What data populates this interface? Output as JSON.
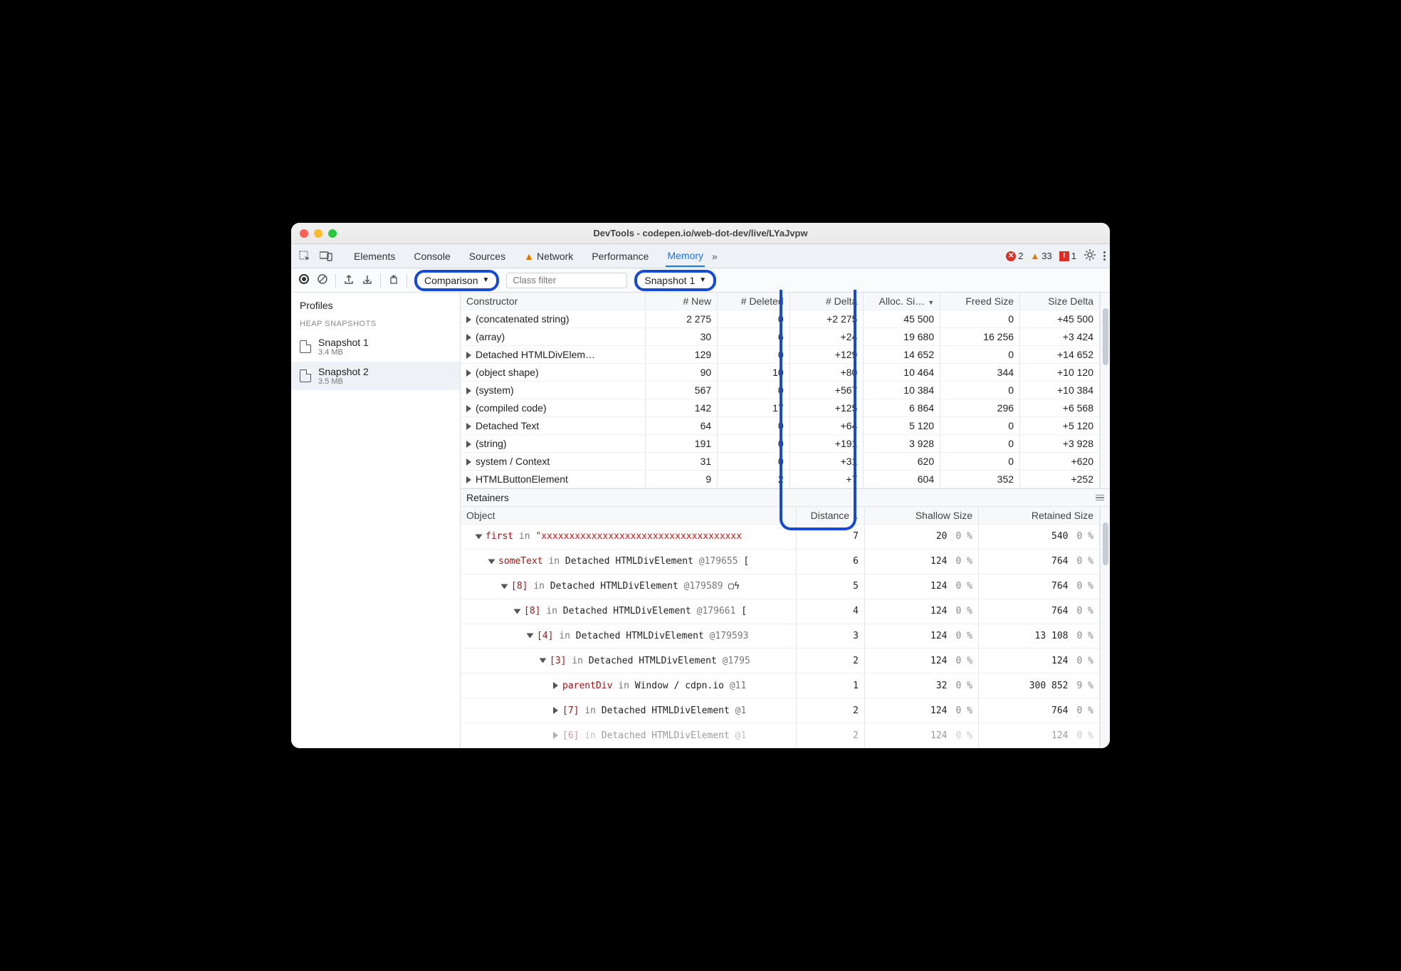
{
  "window_title": "DevTools - codepen.io/web-dot-dev/live/LYaJvpw",
  "tabs": {
    "items": [
      "Elements",
      "Console",
      "Sources",
      "Network",
      "Performance",
      "Memory"
    ],
    "active": "Memory"
  },
  "badges": {
    "errors": 2,
    "warnings": 33,
    "issues": 1
  },
  "toolbar": {
    "view_select": "Comparison",
    "filter_placeholder": "Class filter",
    "baseline_select": "Snapshot 1"
  },
  "sidebar": {
    "title": "Profiles",
    "section": "HEAP SNAPSHOTS",
    "snapshots": [
      {
        "name": "Snapshot 1",
        "size": "3.4 MB",
        "selected": false
      },
      {
        "name": "Snapshot 2",
        "size": "3.5 MB",
        "selected": true
      }
    ]
  },
  "comparison": {
    "headers": [
      "Constructor",
      "# New",
      "# Deleted",
      "# Delta",
      "Alloc. Si…",
      "Freed Size",
      "Size Delta"
    ],
    "sort_col": 4,
    "rows": [
      {
        "name": "(concatenated string)",
        "new": "2 275",
        "del": "0",
        "delta": "+2 275",
        "alloc": "45 500",
        "freed": "0",
        "sized": "+45 500"
      },
      {
        "name": "(array)",
        "new": "30",
        "del": "6",
        "delta": "+24",
        "alloc": "19 680",
        "freed": "16 256",
        "sized": "+3 424"
      },
      {
        "name": "Detached HTMLDivElem…",
        "new": "129",
        "del": "0",
        "delta": "+129",
        "alloc": "14 652",
        "freed": "0",
        "sized": "+14 652"
      },
      {
        "name": "(object shape)",
        "new": "90",
        "del": "10",
        "delta": "+80",
        "alloc": "10 464",
        "freed": "344",
        "sized": "+10 120"
      },
      {
        "name": "(system)",
        "new": "567",
        "del": "0",
        "delta": "+567",
        "alloc": "10 384",
        "freed": "0",
        "sized": "+10 384"
      },
      {
        "name": "(compiled code)",
        "new": "142",
        "del": "17",
        "delta": "+125",
        "alloc": "6 864",
        "freed": "296",
        "sized": "+6 568"
      },
      {
        "name": "Detached Text",
        "new": "64",
        "del": "0",
        "delta": "+64",
        "alloc": "5 120",
        "freed": "0",
        "sized": "+5 120"
      },
      {
        "name": "(string)",
        "new": "191",
        "del": "0",
        "delta": "+191",
        "alloc": "3 928",
        "freed": "0",
        "sized": "+3 928"
      },
      {
        "name": "system / Context",
        "new": "31",
        "del": "0",
        "delta": "+31",
        "alloc": "620",
        "freed": "0",
        "sized": "+620"
      },
      {
        "name": "HTMLButtonElement",
        "new": "9",
        "del": "2",
        "delta": "+7",
        "alloc": "604",
        "freed": "352",
        "sized": "+252"
      }
    ]
  },
  "retainers": {
    "title": "Retainers",
    "headers": [
      "Object",
      "Distance",
      "Shallow Size",
      "Retained Size"
    ],
    "sort_col": 1,
    "rows": [
      {
        "indent": 0,
        "open": true,
        "prop": "first",
        "kw": "in",
        "rest": "\"xxxxxxxxxxxxxxxxxxxxxxxxxxxxxxxxxxxx",
        "dist": "7",
        "sh": "20",
        "shp": "0 %",
        "ret": "540",
        "retp": "0 %",
        "str": true
      },
      {
        "indent": 1,
        "open": true,
        "prop": "someText",
        "kw": "in",
        "rest": "Detached HTMLDivElement @179655 [",
        "dist": "6",
        "sh": "124",
        "shp": "0 %",
        "ret": "764",
        "retp": "0 %"
      },
      {
        "indent": 2,
        "open": true,
        "prop": "[8]",
        "kw": "in",
        "rest": "Detached HTMLDivElement @179589 ▢ϟ",
        "dist": "5",
        "sh": "124",
        "shp": "0 %",
        "ret": "764",
        "retp": "0 %"
      },
      {
        "indent": 3,
        "open": true,
        "prop": "[8]",
        "kw": "in",
        "rest": "Detached HTMLDivElement @179661 [",
        "dist": "4",
        "sh": "124",
        "shp": "0 %",
        "ret": "764",
        "retp": "0 %"
      },
      {
        "indent": 4,
        "open": true,
        "prop": "[4]",
        "kw": "in",
        "rest": "Detached HTMLDivElement @179593",
        "dist": "3",
        "sh": "124",
        "shp": "0 %",
        "ret": "13 108",
        "retp": "0 %"
      },
      {
        "indent": 5,
        "open": true,
        "prop": "[3]",
        "kw": "in",
        "rest": "Detached HTMLDivElement @1795",
        "dist": "2",
        "sh": "124",
        "shp": "0 %",
        "ret": "124",
        "retp": "0 %"
      },
      {
        "indent": 6,
        "open": false,
        "prop": "parentDiv",
        "kw": "in",
        "rest": "Window / cdpn.io @11",
        "dist": "1",
        "sh": "32",
        "shp": "0 %",
        "ret": "300 852",
        "retp": "9 %"
      },
      {
        "indent": 6,
        "open": false,
        "prop": "[7]",
        "kw": "in",
        "rest": "Detached HTMLDivElement @1",
        "dist": "2",
        "sh": "124",
        "shp": "0 %",
        "ret": "764",
        "retp": "0 %"
      },
      {
        "indent": 6,
        "open": false,
        "prop": "[6]",
        "kw": "in",
        "rest": "Detached HTMLDivElement @1",
        "dist": "2",
        "sh": "124",
        "shp": "0 %",
        "ret": "124",
        "retp": "0 %",
        "faded": true
      }
    ]
  }
}
